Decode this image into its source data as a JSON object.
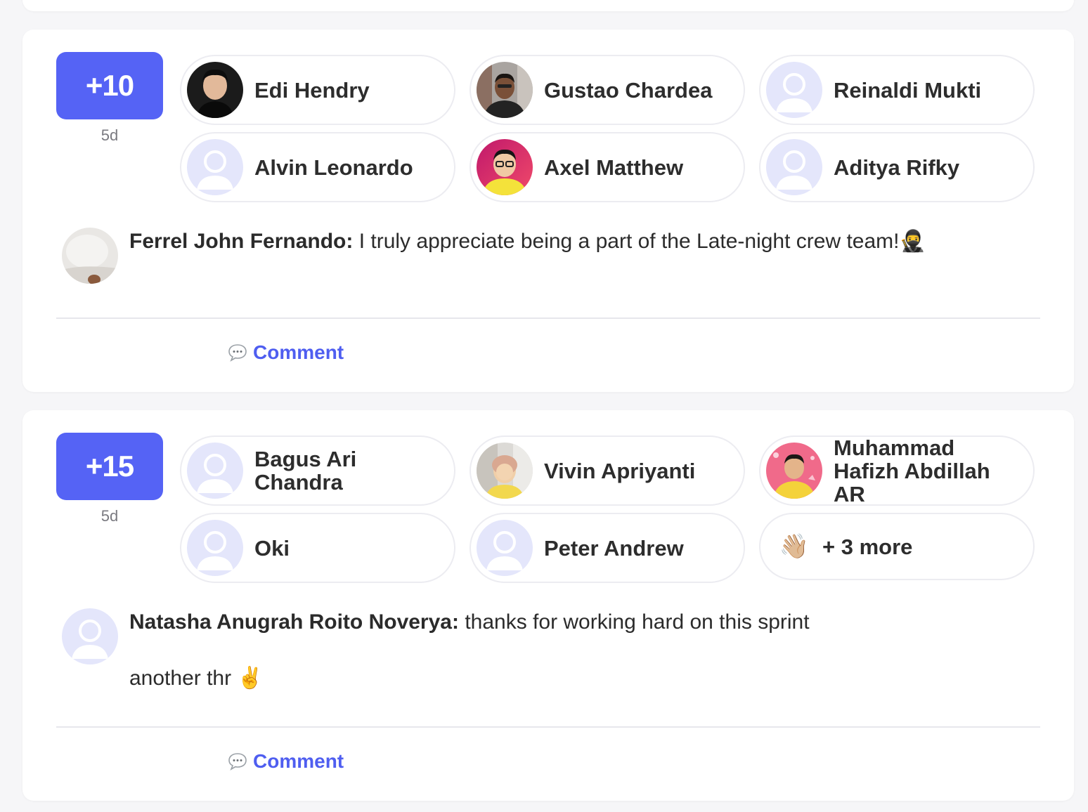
{
  "posts": [
    {
      "points": "+10",
      "age": "5d",
      "recipients": [
        {
          "name": "Edi Hendry",
          "avatar": "photo"
        },
        {
          "name": "Gustao Chardea",
          "avatar": "photo"
        },
        {
          "name": "Reinaldi Mukti",
          "avatar": "placeholder"
        },
        {
          "name": "Alvin Leonardo",
          "avatar": "placeholder"
        },
        {
          "name": "Axel Matthew",
          "avatar": "photo"
        },
        {
          "name": "Aditya Rifky",
          "avatar": "placeholder"
        }
      ],
      "author": "Ferrel John Fernando:",
      "message": " I truly appreciate being a part of the Late-night crew team!🥷",
      "comment_label": "Comment"
    },
    {
      "points": "+15",
      "age": "5d",
      "recipients": [
        {
          "name": "Bagus Ari Chandra",
          "avatar": "placeholder"
        },
        {
          "name": "Vivin Apriyanti",
          "avatar": "photo"
        },
        {
          "name": "Muhammad Hafizh Abdillah AR",
          "avatar": "photo"
        },
        {
          "name": "Oki",
          "avatar": "placeholder"
        },
        {
          "name": "Peter Andrew",
          "avatar": "placeholder"
        }
      ],
      "more": {
        "icon": "👋🏼",
        "label": "+ 3 more"
      },
      "author": "Natasha Anugrah Roito Noverya:",
      "message": " thanks for working hard on this sprint",
      "message_line2": "another thr ✌️",
      "comment_label": "Comment"
    }
  ],
  "colors": {
    "accent": "#5563f5",
    "link": "#4f5ef0",
    "placeholder_avatar": "#e4e6fb",
    "background": "#f6f6f8"
  }
}
